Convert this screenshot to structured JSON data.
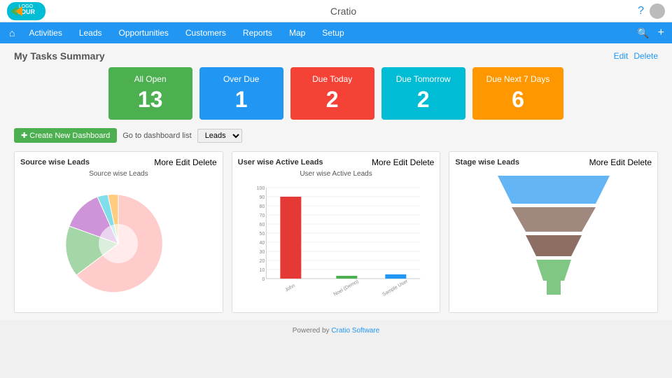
{
  "app": {
    "title": "Cratio"
  },
  "nav": {
    "home_icon": "⌂",
    "items": [
      "Activities",
      "Leads",
      "Opportunities",
      "Customers",
      "Reports",
      "Map",
      "Setup"
    ],
    "search_icon": "🔍",
    "plus_icon": "+"
  },
  "tasks_summary": {
    "title": "My Tasks Summary",
    "edit_label": "Edit",
    "delete_label": "Delete",
    "cards": [
      {
        "label": "All Open",
        "value": "13",
        "color_class": "card-green"
      },
      {
        "label": "Over Due",
        "value": "1",
        "color_class": "card-blue"
      },
      {
        "label": "Due Today",
        "value": "2",
        "color_class": "card-red"
      },
      {
        "label": "Due Tomorrow",
        "value": "2",
        "color_class": "card-cyan"
      },
      {
        "label": "Due Next 7 Days",
        "value": "6",
        "color_class": "card-orange"
      }
    ]
  },
  "dashboard_bar": {
    "create_label": "✚ Create New Dashboard",
    "goto_label": "Go to dashboard list",
    "select_value": "Leads"
  },
  "charts": {
    "source_leads": {
      "title": "Source wise Leads",
      "inner_title": "Source wise Leads",
      "more": "More",
      "edit": "Edit",
      "delete": "Delete"
    },
    "user_leads": {
      "title": "User wise Active Leads",
      "inner_title": "User wise Active Leads",
      "more": "More",
      "edit": "Edit",
      "delete": "Delete",
      "y_labels": [
        "100",
        "90",
        "80",
        "70",
        "60",
        "50",
        "40",
        "30",
        "20",
        "10",
        "0"
      ],
      "bars": [
        {
          "label": "John",
          "value": 85,
          "color": "#E53935"
        },
        {
          "label": "Noel (Demo)",
          "value": 3,
          "color": "#4CAF50"
        },
        {
          "label": "Sample User",
          "value": 5,
          "color": "#2196F3"
        }
      ]
    },
    "stage_leads": {
      "title": "Stage wise Leads",
      "more": "More",
      "edit": "Edit",
      "delete": "Delete"
    }
  },
  "footer": {
    "text": "Powered by ",
    "link_text": "Cratio Software",
    "link_url": "#"
  }
}
